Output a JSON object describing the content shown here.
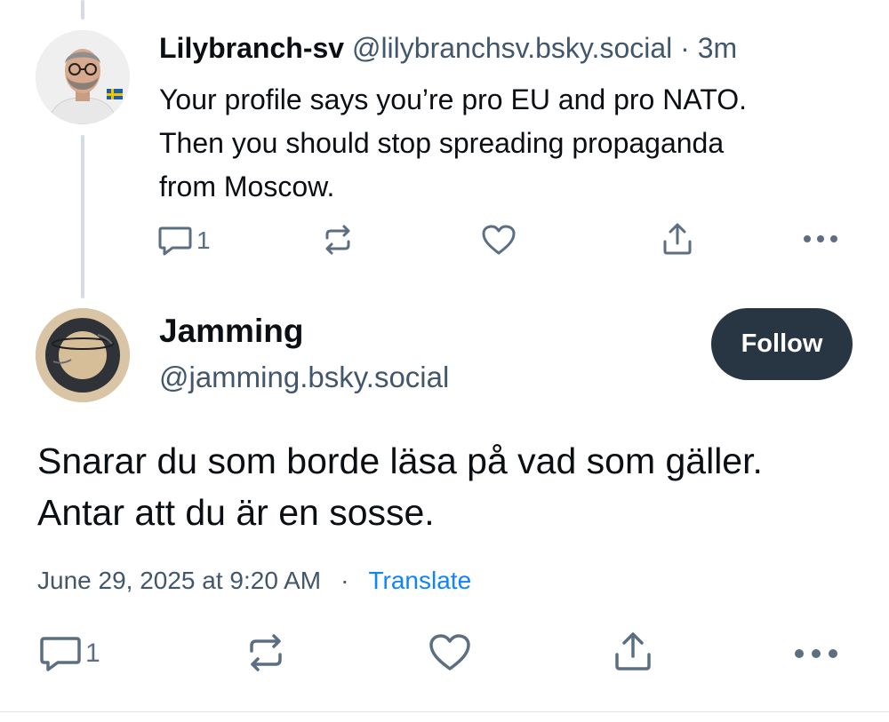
{
  "reply": {
    "author_name": "Lilybranch-sv",
    "handle": "@lilybranchsv.bsky.social",
    "separator": "·",
    "time_ago": "3m",
    "text": "Your profile says you’re pro EU and pro NATO. Then you should stop spreading propaganda from Moscow.",
    "reply_count": "1",
    "avatar_icon": "bearded-man-avatar",
    "flag_icon": "sweden-flag-icon"
  },
  "post": {
    "author_name": "Jamming",
    "handle": "@jamming.bsky.social",
    "follow_label": "Follow",
    "text": "Snarar du som borde läsa på vad som gäller. Antar att du är en sosse.",
    "timestamp": "June 29, 2025 at 9:20 AM",
    "separator": "·",
    "translate_label": "Translate",
    "reply_count": "1",
    "avatar_icon": "inner-tube-avatar"
  },
  "colors": {
    "primary_text": "#0b0f14",
    "secondary_text": "#42576c",
    "icon": "#5b6e82",
    "link": "#1083fe",
    "follow_bg": "#283543",
    "thread_line": "#d4dbe2"
  },
  "icons": {
    "reply": "speech-bubble-icon",
    "repost": "repost-arrows-icon",
    "like": "heart-icon",
    "share": "share-upload-icon",
    "more": "more-dots-icon"
  }
}
